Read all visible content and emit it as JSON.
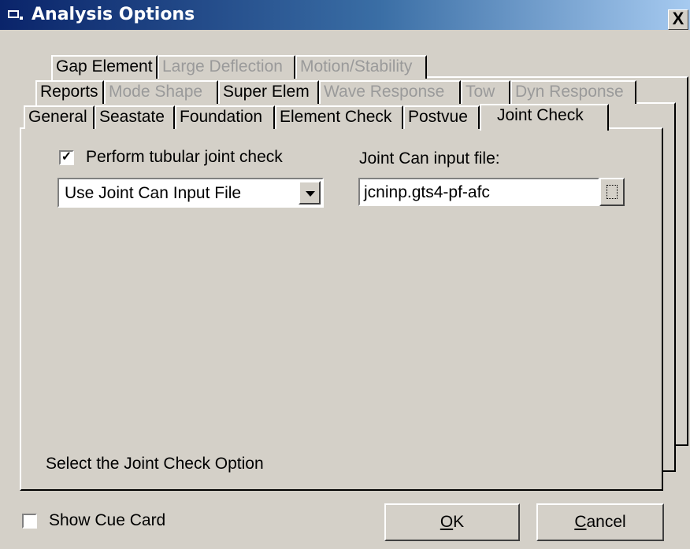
{
  "window": {
    "title": "Analysis Options",
    "close_label": "X"
  },
  "tabs": {
    "row1": [
      {
        "label": "Gap Element",
        "disabled": false
      },
      {
        "label": "Large Deflection",
        "disabled": true
      },
      {
        "label": "Motion/Stability",
        "disabled": true
      }
    ],
    "row2": [
      {
        "label": "Reports",
        "disabled": false
      },
      {
        "label": "Mode Shape",
        "disabled": true
      },
      {
        "label": "Super Elem",
        "disabled": false
      },
      {
        "label": "Wave Response",
        "disabled": true
      },
      {
        "label": "Tow",
        "disabled": true
      },
      {
        "label": "Dyn Response",
        "disabled": true
      }
    ],
    "row3": [
      {
        "label": "General",
        "disabled": false
      },
      {
        "label": "Seastate",
        "disabled": false
      },
      {
        "label": "Foundation",
        "disabled": false
      },
      {
        "label": "Element Check",
        "disabled": false
      },
      {
        "label": "Postvue",
        "disabled": false
      },
      {
        "label": "Joint Check",
        "disabled": false,
        "active": true
      }
    ]
  },
  "joint_check": {
    "perform_check_label": "Perform tubular joint check",
    "perform_check_checked": true,
    "option_selected": "Use Joint Can Input File",
    "input_file_label": "Joint Can input file:",
    "input_file_value": "jcninp.gts4-pf-afc",
    "status_text": "Select the Joint Check Option"
  },
  "footer": {
    "show_cue_card_label": "Show Cue Card",
    "show_cue_card_checked": false,
    "ok_label_underlined": "O",
    "ok_label_rest": "K",
    "cancel_label_underlined": "C",
    "cancel_label_rest": "ancel"
  }
}
